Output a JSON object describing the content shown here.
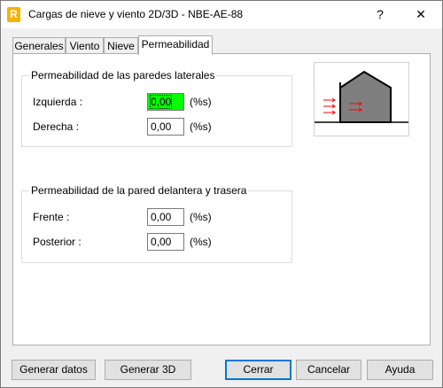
{
  "window": {
    "title": "Cargas de nieve y viento 2D/3D - NBE-AE-88",
    "app_icon_letter": "R",
    "help_glyph": "?",
    "close_glyph": "✕"
  },
  "tabs": [
    {
      "label": "Generales",
      "active": false
    },
    {
      "label": "Viento",
      "active": false
    },
    {
      "label": "Nieve",
      "active": false
    },
    {
      "label": "Permeabilidad",
      "active": true
    }
  ],
  "lateral": {
    "title": "Permeabilidad de las paredes laterales",
    "left": {
      "label": "Izquierda :",
      "value": "0,00",
      "unit": "(%s)"
    },
    "right": {
      "label": "Derecha :",
      "value": "0,00",
      "unit": "(%s)"
    }
  },
  "front_back": {
    "title": "Permeabilidad de la pared delantera y trasera",
    "front": {
      "label": "Frente :",
      "value": "0,00",
      "unit": "(%s)"
    },
    "back": {
      "label": "Posterior :",
      "value": "0,00",
      "unit": "(%s)"
    }
  },
  "buttons": {
    "generate_data": "Generar datos",
    "generate_3d": "Generar 3D",
    "close": "Cerrar",
    "cancel": "Cancelar",
    "help": "Ayuda"
  },
  "colors": {
    "focused_field": "#00ff00",
    "preview_building": "#7f7f7f",
    "wind_arrows": "#ff0000",
    "default_button_border": "#0078d7"
  }
}
